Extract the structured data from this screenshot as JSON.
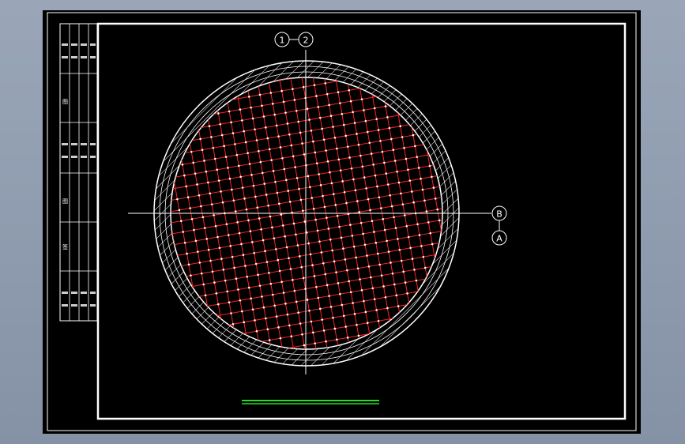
{
  "colors": {
    "viewport_bg": "#8f9bb0",
    "sheet": "#000000",
    "line": "#ffffff",
    "grid": "#ff2020",
    "scale_bar": "#22dd22"
  },
  "axes": {
    "vertical_left": "1",
    "vertical_right": "2",
    "horizontal_top": "B",
    "horizontal_bottom": "A"
  },
  "title_block": {
    "label_1": "图",
    "label_2": "图",
    "label_3": "签"
  }
}
